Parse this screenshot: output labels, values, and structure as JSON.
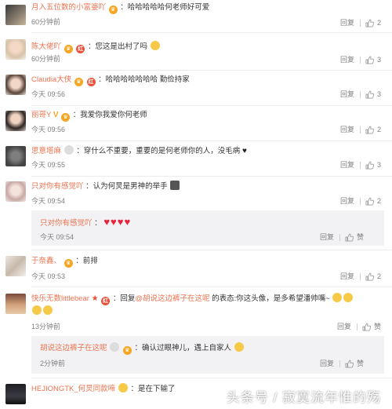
{
  "actions": {
    "reply": "回复",
    "like": "赞"
  },
  "comments": [
    {
      "user": "月入五位数的小富婆吖",
      "text": "：哈哈哈哈哈何老师好可爱",
      "time": "60分钟前",
      "likes": "2"
    },
    {
      "user": "陈大佬吖",
      "text": "：您这是出村了吗",
      "time": "60分钟前",
      "likes": "3"
    },
    {
      "user": "Claudia大侠",
      "text": "：哈哈哈哈哈哈哈 勤俭持家",
      "time": "今天 09:56",
      "likes": "3"
    },
    {
      "user": "丽哥Y",
      "text": "：我爱你我爱你何老师",
      "time": "今天 09:56",
      "likes": "2"
    },
    {
      "user": "思意塔麻",
      "text": "：穿什么不重要，重要的是何老师你的人，没毛病",
      "time": "今天 09:55",
      "likes": "3"
    },
    {
      "user": "只对你有感觉吖",
      "text": "：认为何炅是男神的举手",
      "time": "今天 09:54",
      "likes": "2"
    },
    {
      "user": "于奈鑫、",
      "text": "：前排",
      "time": "今天 09:53",
      "likes": "2"
    },
    {
      "user": "快乐无数littlebear",
      "text_prefix": "：回复",
      "mention": "@胡说这边裤子在这呢",
      "text_suffix": " 的表态:你这头像，是多希望潘帅嘴~",
      "time": "13分钟前"
    },
    {
      "user": "HEJIONGTK_何炅同款啼",
      "text": "：是在下输了"
    }
  ],
  "replies": [
    {
      "user": "只对你有感觉吖",
      "text": "：",
      "time": "今天 09:54"
    },
    {
      "user": "胡说这边裤子在这呢",
      "text": "：确认过眼神儿，遇上自家人",
      "time": "2分钟前"
    }
  ],
  "watermark": "头条号 / 寂寞流年惟的殇",
  "colors": {
    "username": "#eb7350",
    "reply_bg": "#f2f2f5",
    "heart": "#e8233a"
  }
}
